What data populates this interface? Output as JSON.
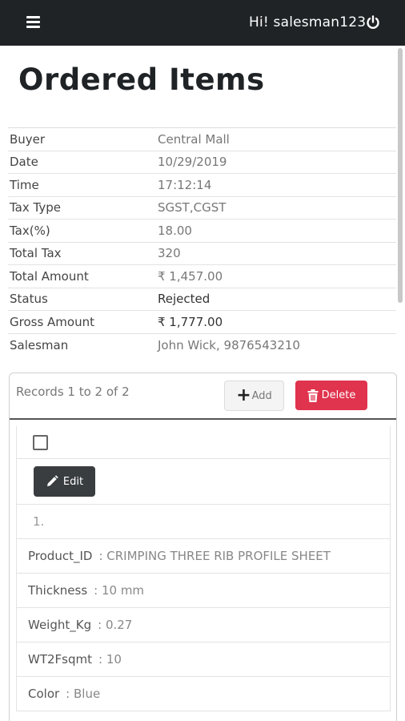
{
  "header": {
    "greeting": "Hi! salesman123"
  },
  "page": {
    "title": "Ordered Items"
  },
  "info": [
    {
      "label": "Buyer",
      "value": "Central Mall"
    },
    {
      "label": "Date",
      "value": "10/29/2019"
    },
    {
      "label": "Time",
      "value": "17:12:14"
    },
    {
      "label": "Tax Type",
      "value": "SGST,CGST"
    },
    {
      "label": "Tax(%)",
      "value": "18.00"
    },
    {
      "label": "Total Tax",
      "value": "320"
    },
    {
      "label": "Total Amount",
      "value": "₹ 1,457.00"
    },
    {
      "label": "Status",
      "value": "Rejected"
    },
    {
      "label": "Gross Amount",
      "value": "₹ 1,777.00"
    },
    {
      "label": "Salesman",
      "value": "John Wick, 9876543210"
    }
  ],
  "records": {
    "summary": "Records 1 to 2 of 2",
    "add_label": "Add",
    "delete_label": "Delete",
    "edit_label": "Edit",
    "item_number": "1.",
    "fields": [
      {
        "key": "Product_ID",
        "value": ": CRIMPING THREE RIB PROFILE SHEET"
      },
      {
        "key": "Thickness",
        "value": ": 10 mm"
      },
      {
        "key": "Weight_Kg",
        "value": ": 0.27"
      },
      {
        "key": "WT2Fsqmt",
        "value": ": 10"
      },
      {
        "key": "Color",
        "value": ": Blue"
      }
    ]
  },
  "colors": {
    "topbar": "#1f2326",
    "delete": "#e0334d",
    "edit": "#3a3d40"
  },
  "icons": [
    "hamburger-menu-icon",
    "power-icon",
    "plus-icon",
    "trash-icon",
    "pencil-icon"
  ]
}
